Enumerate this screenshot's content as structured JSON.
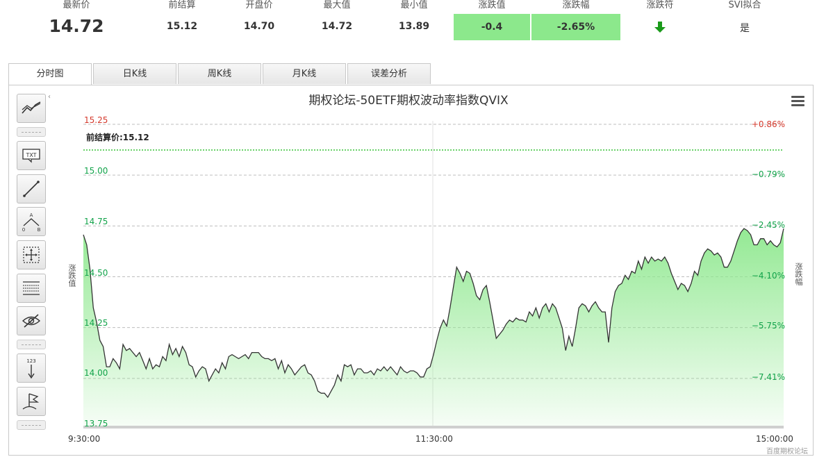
{
  "quote": {
    "latest": {
      "label": "最新价",
      "value": "14.72"
    },
    "prev_settle": {
      "label": "前结算",
      "value": "15.12"
    },
    "open": {
      "label": "开盘价",
      "value": "14.70"
    },
    "high": {
      "label": "最大值",
      "value": "14.72"
    },
    "low": {
      "label": "最小值",
      "value": "13.89"
    },
    "change": {
      "label": "涨跌值",
      "value": "-0.4"
    },
    "change_pct": {
      "label": "涨跌幅",
      "value": "-2.65%"
    },
    "direction": {
      "label": "涨跌符",
      "icon": "arrow-down-icon"
    },
    "svi": {
      "label": "SVI拟合",
      "value": "是"
    }
  },
  "tabs": [
    {
      "label": "分时图",
      "active": true
    },
    {
      "label": "日K线",
      "active": false
    },
    {
      "label": "周K线",
      "active": false
    },
    {
      "label": "月K线",
      "active": false
    },
    {
      "label": "误差分析",
      "active": false
    }
  ],
  "tools": [
    "trend-icon",
    "text-icon",
    "line-icon",
    "abc-icon",
    "move-icon",
    "grid-icon",
    "hide-icon",
    "measure-icon",
    "flag-icon"
  ],
  "chart": {
    "title": "期权论坛-50ETF期权波动率指数QVIX",
    "prev_close_label": "前结算价:15.12",
    "left_axis_title": "涨跌值",
    "right_axis_title": "涨跌幅",
    "credit": "百度期权论坛"
  },
  "colors": {
    "up": "#d4382b",
    "down": "#12a34a",
    "fill": "#8ee88e",
    "box": "#8ce88c"
  },
  "chart_data": {
    "type": "area",
    "title": "期权论坛-50ETF期权波动率指数QVIX",
    "ylabel": "涨跌值",
    "y2label": "涨跌幅",
    "ylim": [
      13.75,
      15.25
    ],
    "x_ticks": [
      "9:30:00",
      "11:30:00",
      "15:00:00"
    ],
    "y_ticks": [
      "15.25",
      "15.00",
      "14.75",
      "14.50",
      "14.25",
      "14.00",
      "13.75"
    ],
    "y2_ticks": [
      "+0.86%",
      "−0.79%",
      "−2.45%",
      "−4.10%",
      "−5.75%",
      "−7.41%"
    ],
    "prev_close": 15.12,
    "values": [
      14.69,
      14.64,
      14.52,
      14.33,
      14.26,
      14.17,
      14.14,
      14.04,
      14.04,
      14.08,
      14.06,
      14.03,
      14.15,
      14.12,
      14.13,
      14.11,
      14.09,
      14.11,
      14.07,
      14.03,
      14.08,
      14.03,
      14.05,
      14.04,
      14.09,
      14.07,
      14.15,
      14.1,
      14.13,
      14.09,
      14.14,
      14.11,
      14.05,
      14.04,
      13.99,
      14.02,
      14.04,
      14.03,
      13.97,
      14.0,
      14.03,
      14.01,
      14.06,
      14.03,
      14.09,
      14.1,
      14.09,
      14.08,
      14.09,
      14.1,
      14.08,
      14.11,
      14.11,
      14.11,
      14.09,
      14.08,
      14.08,
      14.07,
      14.08,
      14.03,
      14.07,
      14.01,
      14.05,
      14.03,
      14.0,
      14.02,
      14.04,
      14.05,
      14.01,
      14.0,
      13.97,
      13.92,
      13.91,
      13.91,
      13.89,
      13.92,
      13.95,
      14.0,
      13.97,
      14.05,
      14.04,
      14.05,
      14.0,
      14.03,
      14.03,
      14.01,
      14.01,
      14.02,
      14.0,
      14.03,
      14.02,
      14.04,
      14.02,
      14.04,
      14.02,
      14.0,
      14.04,
      14.02,
      14.01,
      14.02,
      14.02,
      14.01,
      13.99,
      13.99,
      14.03,
      14.04,
      14.1,
      14.17,
      14.23,
      14.27,
      14.24,
      14.33,
      14.43,
      14.53,
      14.5,
      14.46,
      14.51,
      14.5,
      14.45,
      14.39,
      14.37,
      14.42,
      14.44,
      14.36,
      14.27,
      14.18,
      14.2,
      14.22,
      14.25,
      14.27,
      14.26,
      14.28,
      14.27,
      14.27,
      14.26,
      14.31,
      14.29,
      14.33,
      14.28,
      14.33,
      14.35,
      14.31,
      14.35,
      14.33,
      14.28,
      14.23,
      14.12,
      14.19,
      14.14,
      14.23,
      14.33,
      14.35,
      14.34,
      14.31,
      14.34,
      14.36,
      14.33,
      14.31,
      14.31,
      14.16,
      14.33,
      14.41,
      14.44,
      14.45,
      14.49,
      14.47,
      14.51,
      14.5,
      14.56,
      14.52,
      14.58,
      14.55,
      14.58,
      14.56,
      14.57,
      14.56,
      14.58,
      14.55,
      14.5,
      14.46,
      14.42,
      14.45,
      14.44,
      14.41,
      14.45,
      14.51,
      14.49,
      14.56,
      14.6,
      14.62,
      14.61,
      14.59,
      14.6,
      14.58,
      14.53,
      14.53,
      14.56,
      14.61,
      14.66,
      14.7,
      14.72,
      14.71,
      14.69,
      14.64,
      14.64,
      14.67,
      14.67,
      14.64,
      14.66,
      14.64,
      14.63,
      14.65,
      14.72
    ]
  }
}
